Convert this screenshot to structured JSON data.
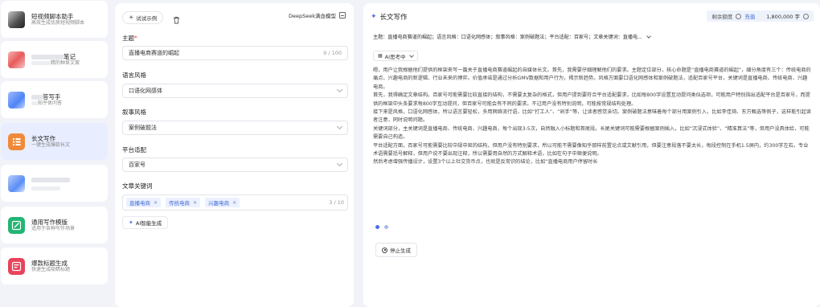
{
  "sidebar": {
    "items": [
      {
        "title": "短视频脚本助手",
        "subtitle": "高效生成优质短视频脚本",
        "color": "#777777"
      },
      {
        "title": "笔记",
        "subtitle": "精的种草文案",
        "color": "#e85a5a"
      },
      {
        "title": "答写手",
        "subtitle": "知乎体问答",
        "color": "#4f84f7"
      },
      {
        "title": "长文写作",
        "subtitle": "一键生成爆款长文",
        "color": "#f08a3a",
        "icon": "list-doc-icon"
      },
      {
        "title": "",
        "subtitle": "",
        "color": "#5a8ef5"
      },
      {
        "title": "通用写作模版",
        "subtitle": "适用于各种写作场景",
        "color": "#22b573",
        "icon": "edit-icon"
      },
      {
        "title": "爆款标题生成",
        "subtitle": "快速生成吸睛标题",
        "color": "#e8435a",
        "icon": "title-icon"
      }
    ]
  },
  "form": {
    "try_example": "试试示例",
    "model": "DeepSeek满血模型",
    "topic_label": "主题",
    "topic_required": "*",
    "topic_value": "直播电商赛道的崛起",
    "topic_count": "9 / 100",
    "style_label": "语言风格",
    "style_value": "口语化网感体",
    "narrative_label": "叙事风格",
    "narrative_value": "案例破题法",
    "platform_label": "平台适配",
    "platform_value": "百家号",
    "keywords_label": "文章关键词",
    "keywords": [
      "直播电商",
      "传统电商",
      "兴趣电商"
    ],
    "keywords_count": "3 / 10",
    "ai_generate": "AI智能生成"
  },
  "result": {
    "title": "长文写作",
    "quota_label": "剩余额度",
    "recharge": "充值",
    "quota_value": "1,800,000 字",
    "summary": "主题：直播电商赛道的崛起；语言风格：口语化网感体；叙事风格：案例破题法；平台适配：百家号；文章关键词：直播电...",
    "think_label": "AI思考中",
    "paragraphs": [
      "嗯，用户让我根据他们提供的框架来写一篇关于直播电商赛道崛起的自媒体长文。首先，我需要仔细理解他们的要求。主题定位部分，核心命题是“直播电商赛道的崛起”，细分角度有三个：传统电商的痛点、兴趣电商的新逻辑、行业未来的博弈。价值承诺是通过分析GMV数据和用户行为，揭示新趋势。风格方面要口语化网感体和案例破题法，适配百家号平台，关键词是直播电商、传统电商、兴趣电商。",
      "首先，我得确定文章结构。百家号可能需要比较直接的结构，不需要太复杂的格式，但用户提到要符合平台适配要求，比如每800字设置互动提问类似选项，可能用户特别指出适配平台是百家号，而提供的框架中头条要求每800字互动提问，但百家号可能会有不同的要求。不过用户没有特别说明，可能按常规结构处理。",
      "接下来是风格，口语化网感体，所以语言要轻松，多用网络流行语，比如“打工人”、“剁手”等，让读者感觉亲切。案例破题法意味着每个部分用案例引入，比如李佳琦、东方甄选等例子，这样能引起读者注意，同时说明问题。",
      "关键词部分，主关键词是直播电商、传统电商、兴趣电商，每个出现3-5次，自然融入小标题和首尾段。长尾关键词可能需要根据案例插入，比如“沉浸式体验”、“精准算法”等，但用户没具体给，可能需要自己构造。",
      "平台适配方面，百家号可能需要比较中规中矩的结构，但用户没有特别要求，所以可能不需要像知乎那样前置论点或文献引用，但要注意段落不要太长，每段控制在手机1.5屏内，约300字左右。专业术语需要括号解释，但用户说不要出现注释，所以需要用自然的方式解释术语，比如在句子中顺便说明。",
      "然后考虑增强传播设计，设置3个以上社交货币点，也就是反常识的结论，比如“直播电商用户停留时长"
    ],
    "stop_label": "停止生成"
  }
}
